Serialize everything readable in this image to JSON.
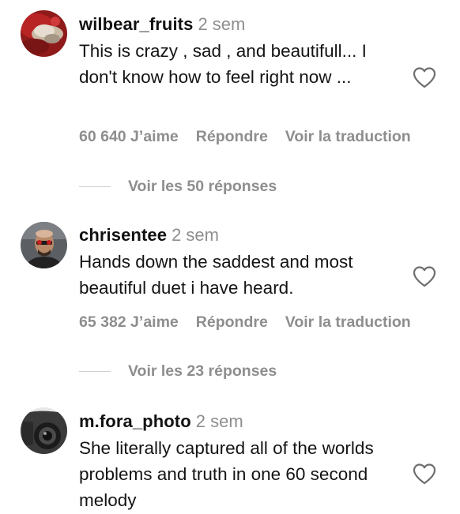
{
  "comments": [
    {
      "username": "wilbear_fruits",
      "time": "2 sem",
      "text": "This is crazy , sad , and beautifull... I don't know how to feel right now ...",
      "likes": "60 640 J’aime",
      "reply_label": "Répondre",
      "translate_label": "Voir la traduction",
      "replies_label": "Voir les 50 réponses"
    },
    {
      "username": "chrisentee",
      "time": "2 sem",
      "text": "Hands down the saddest and most beautiful duet i have heard.",
      "likes": "65 382 J’aime",
      "reply_label": "Répondre",
      "translate_label": "Voir la traduction",
      "replies_label": "Voir les 23 réponses"
    },
    {
      "username": "m.fora_photo",
      "time": "2 sem",
      "text": "She literally captured all of the worlds problems and truth in one 60 second melody"
    }
  ],
  "icons": {
    "like": "heart-outline-icon"
  },
  "colors": {
    "username": "#111111",
    "meta": "#8e8e8e",
    "text": "#141414",
    "background": "#ffffff"
  }
}
